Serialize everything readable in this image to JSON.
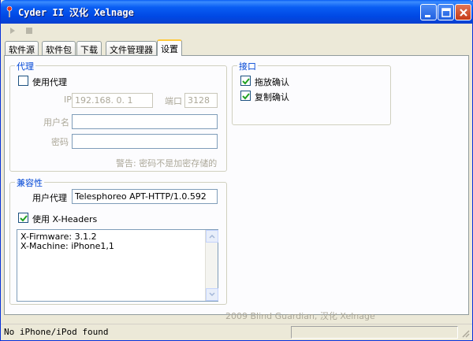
{
  "window": {
    "title": "Cyder II 汉化 Xelnage"
  },
  "toolbar": {
    "play_icon": "play-icon",
    "stop_icon": "stop-icon"
  },
  "tabs": [
    {
      "label": "软件源"
    },
    {
      "label": "软件包"
    },
    {
      "label": "下载"
    },
    {
      "label": "文件管理器"
    },
    {
      "label": "设置",
      "active": true
    }
  ],
  "proxy": {
    "title": "代理",
    "use_proxy_label": "使用代理",
    "use_proxy_checked": false,
    "ip_label": "IP",
    "ip_value": "192.168.  0.  1",
    "port_label": "端口",
    "port_value": "3128",
    "username_label": "用户名",
    "username_value": "",
    "password_label": "密码",
    "password_value": "",
    "warning": "警告: 密码不是加密存储的"
  },
  "interface": {
    "title": "接口",
    "drag_confirm_label": "拖放确认",
    "drag_confirm_checked": true,
    "copy_confirm_label": "复制确认",
    "copy_confirm_checked": true
  },
  "compat": {
    "title": "兼容性",
    "user_agent_label": "用户代理",
    "user_agent_value": "Telesphoreo APT-HTTP/1.0.592",
    "xheaders_label": "使用 X-Headers",
    "xheaders_checked": true,
    "headers": [
      "X-Firmware: 3.1.2",
      "X-Machine: iPhone1,1"
    ]
  },
  "credit": "2009 Blind Guardian, 汉化 Xelnage",
  "status": {
    "text": "No iPhone/iPod found"
  },
  "colors": {
    "titlebar": "#0a5ef4",
    "group_title": "#0046d5",
    "active_tab_accent": "#ffc83c"
  }
}
